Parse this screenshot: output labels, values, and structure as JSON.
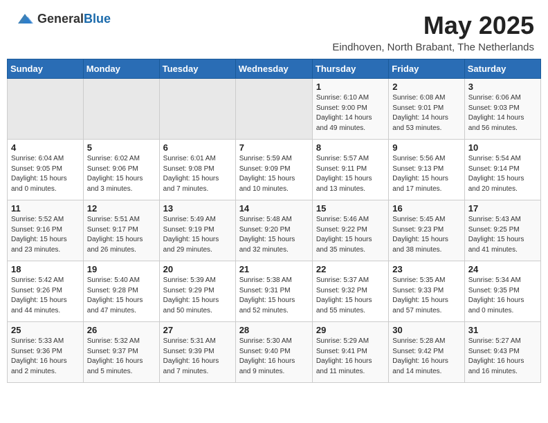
{
  "header": {
    "logo_general": "General",
    "logo_blue": "Blue",
    "month": "May 2025",
    "location": "Eindhoven, North Brabant, The Netherlands"
  },
  "weekdays": [
    "Sunday",
    "Monday",
    "Tuesday",
    "Wednesday",
    "Thursday",
    "Friday",
    "Saturday"
  ],
  "weeks": [
    [
      {
        "day": "",
        "info": ""
      },
      {
        "day": "",
        "info": ""
      },
      {
        "day": "",
        "info": ""
      },
      {
        "day": "",
        "info": ""
      },
      {
        "day": "1",
        "info": "Sunrise: 6:10 AM\nSunset: 9:00 PM\nDaylight: 14 hours\nand 49 minutes."
      },
      {
        "day": "2",
        "info": "Sunrise: 6:08 AM\nSunset: 9:01 PM\nDaylight: 14 hours\nand 53 minutes."
      },
      {
        "day": "3",
        "info": "Sunrise: 6:06 AM\nSunset: 9:03 PM\nDaylight: 14 hours\nand 56 minutes."
      }
    ],
    [
      {
        "day": "4",
        "info": "Sunrise: 6:04 AM\nSunset: 9:05 PM\nDaylight: 15 hours\nand 0 minutes."
      },
      {
        "day": "5",
        "info": "Sunrise: 6:02 AM\nSunset: 9:06 PM\nDaylight: 15 hours\nand 3 minutes."
      },
      {
        "day": "6",
        "info": "Sunrise: 6:01 AM\nSunset: 9:08 PM\nDaylight: 15 hours\nand 7 minutes."
      },
      {
        "day": "7",
        "info": "Sunrise: 5:59 AM\nSunset: 9:09 PM\nDaylight: 15 hours\nand 10 minutes."
      },
      {
        "day": "8",
        "info": "Sunrise: 5:57 AM\nSunset: 9:11 PM\nDaylight: 15 hours\nand 13 minutes."
      },
      {
        "day": "9",
        "info": "Sunrise: 5:56 AM\nSunset: 9:13 PM\nDaylight: 15 hours\nand 17 minutes."
      },
      {
        "day": "10",
        "info": "Sunrise: 5:54 AM\nSunset: 9:14 PM\nDaylight: 15 hours\nand 20 minutes."
      }
    ],
    [
      {
        "day": "11",
        "info": "Sunrise: 5:52 AM\nSunset: 9:16 PM\nDaylight: 15 hours\nand 23 minutes."
      },
      {
        "day": "12",
        "info": "Sunrise: 5:51 AM\nSunset: 9:17 PM\nDaylight: 15 hours\nand 26 minutes."
      },
      {
        "day": "13",
        "info": "Sunrise: 5:49 AM\nSunset: 9:19 PM\nDaylight: 15 hours\nand 29 minutes."
      },
      {
        "day": "14",
        "info": "Sunrise: 5:48 AM\nSunset: 9:20 PM\nDaylight: 15 hours\nand 32 minutes."
      },
      {
        "day": "15",
        "info": "Sunrise: 5:46 AM\nSunset: 9:22 PM\nDaylight: 15 hours\nand 35 minutes."
      },
      {
        "day": "16",
        "info": "Sunrise: 5:45 AM\nSunset: 9:23 PM\nDaylight: 15 hours\nand 38 minutes."
      },
      {
        "day": "17",
        "info": "Sunrise: 5:43 AM\nSunset: 9:25 PM\nDaylight: 15 hours\nand 41 minutes."
      }
    ],
    [
      {
        "day": "18",
        "info": "Sunrise: 5:42 AM\nSunset: 9:26 PM\nDaylight: 15 hours\nand 44 minutes."
      },
      {
        "day": "19",
        "info": "Sunrise: 5:40 AM\nSunset: 9:28 PM\nDaylight: 15 hours\nand 47 minutes."
      },
      {
        "day": "20",
        "info": "Sunrise: 5:39 AM\nSunset: 9:29 PM\nDaylight: 15 hours\nand 50 minutes."
      },
      {
        "day": "21",
        "info": "Sunrise: 5:38 AM\nSunset: 9:31 PM\nDaylight: 15 hours\nand 52 minutes."
      },
      {
        "day": "22",
        "info": "Sunrise: 5:37 AM\nSunset: 9:32 PM\nDaylight: 15 hours\nand 55 minutes."
      },
      {
        "day": "23",
        "info": "Sunrise: 5:35 AM\nSunset: 9:33 PM\nDaylight: 15 hours\nand 57 minutes."
      },
      {
        "day": "24",
        "info": "Sunrise: 5:34 AM\nSunset: 9:35 PM\nDaylight: 16 hours\nand 0 minutes."
      }
    ],
    [
      {
        "day": "25",
        "info": "Sunrise: 5:33 AM\nSunset: 9:36 PM\nDaylight: 16 hours\nand 2 minutes."
      },
      {
        "day": "26",
        "info": "Sunrise: 5:32 AM\nSunset: 9:37 PM\nDaylight: 16 hours\nand 5 minutes."
      },
      {
        "day": "27",
        "info": "Sunrise: 5:31 AM\nSunset: 9:39 PM\nDaylight: 16 hours\nand 7 minutes."
      },
      {
        "day": "28",
        "info": "Sunrise: 5:30 AM\nSunset: 9:40 PM\nDaylight: 16 hours\nand 9 minutes."
      },
      {
        "day": "29",
        "info": "Sunrise: 5:29 AM\nSunset: 9:41 PM\nDaylight: 16 hours\nand 11 minutes."
      },
      {
        "day": "30",
        "info": "Sunrise: 5:28 AM\nSunset: 9:42 PM\nDaylight: 16 hours\nand 14 minutes."
      },
      {
        "day": "31",
        "info": "Sunrise: 5:27 AM\nSunset: 9:43 PM\nDaylight: 16 hours\nand 16 minutes."
      }
    ]
  ]
}
